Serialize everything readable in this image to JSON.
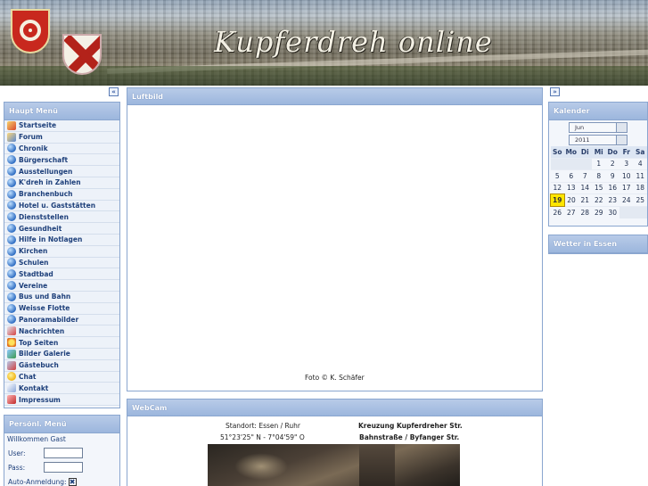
{
  "banner": {
    "title": "Kupferdreh online"
  },
  "nav_toggles": {
    "left": "«",
    "right": "»"
  },
  "main_menu": {
    "title": "Haupt Menü",
    "items": [
      {
        "label": "Startseite",
        "icon": "home-icon"
      },
      {
        "label": "Forum",
        "icon": "forum-icon"
      },
      {
        "label": "Chronik",
        "icon": "globe-icon"
      },
      {
        "label": "Bürgerschaft",
        "icon": "globe-icon"
      },
      {
        "label": "Ausstellungen",
        "icon": "globe-icon"
      },
      {
        "label": "K'dreh in Zahlen",
        "icon": "globe-icon"
      },
      {
        "label": "Branchenbuch",
        "icon": "globe-icon"
      },
      {
        "label": "Hotel u. Gaststätten",
        "icon": "globe-icon"
      },
      {
        "label": "Dienststellen",
        "icon": "globe-icon"
      },
      {
        "label": "Gesundheit",
        "icon": "globe-icon"
      },
      {
        "label": "Hilfe in Notlagen",
        "icon": "globe-icon"
      },
      {
        "label": "Kirchen",
        "icon": "globe-icon"
      },
      {
        "label": "Schulen",
        "icon": "globe-icon"
      },
      {
        "label": "Stadtbad",
        "icon": "globe-icon"
      },
      {
        "label": "Vereine",
        "icon": "globe-icon"
      },
      {
        "label": "Bus und Bahn",
        "icon": "globe-icon"
      },
      {
        "label": "Weisse Flotte",
        "icon": "globe-icon"
      },
      {
        "label": "Panoramabilder",
        "icon": "globe-icon"
      },
      {
        "label": "Nachrichten",
        "icon": "news-icon"
      },
      {
        "label": "Top Seiten",
        "icon": "star-icon"
      },
      {
        "label": "Bilder Galerie",
        "icon": "gallery-icon"
      },
      {
        "label": "Gästebuch",
        "icon": "guestbook-icon"
      },
      {
        "label": "Chat",
        "icon": "chat-icon"
      },
      {
        "label": "Kontakt",
        "icon": "contact-icon"
      },
      {
        "label": "Impressum",
        "icon": "imprint-icon"
      }
    ]
  },
  "personal_menu": {
    "title": "Persönl. Menü",
    "welcome": "Willkommen Gast",
    "user_label": "User:",
    "pass_label": "Pass:",
    "auto_login_label": "Auto-Anmeldung:",
    "auto_login_mark": "✖"
  },
  "luftbild": {
    "title": "Luftbild",
    "caption": "Foto © K. Schäfer"
  },
  "webcam": {
    "title": "WebCam",
    "location_line1": "Standort: Essen / Ruhr",
    "location_line2": "51°23'25\" N - 7°04'59\" O",
    "street_line1": "Kreuzung Kupferdreher Str.",
    "street_line2": "Bahnstraße / Byfanger Str."
  },
  "calendar": {
    "title": "Kalender",
    "month": "Jun",
    "year": "2011",
    "weekdays": [
      "So",
      "Mo",
      "Di",
      "Mi",
      "Do",
      "Fr",
      "Sa"
    ],
    "weeks": [
      [
        "",
        "",
        "",
        "1",
        "2",
        "3",
        "4"
      ],
      [
        "5",
        "6",
        "7",
        "8",
        "9",
        "10",
        "11"
      ],
      [
        "12",
        "13",
        "14",
        "15",
        "16",
        "17",
        "18"
      ],
      [
        "19",
        "20",
        "21",
        "22",
        "23",
        "24",
        "25"
      ],
      [
        "26",
        "27",
        "28",
        "29",
        "30",
        "",
        ""
      ]
    ],
    "today": "19"
  },
  "weather": {
    "title": "Wetter in Essen"
  }
}
